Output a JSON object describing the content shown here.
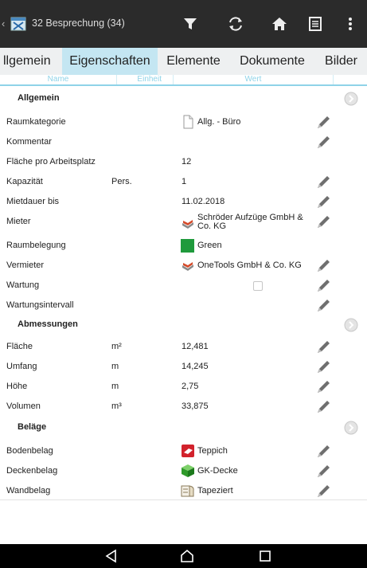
{
  "header": {
    "back_glyph": "‹",
    "title": "32 Besprechung (34)",
    "actions": [
      "filter-icon",
      "sync-icon",
      "home-icon",
      "list-icon",
      "more-vert-icon"
    ]
  },
  "tabs": [
    {
      "label": "llgemein",
      "active": false
    },
    {
      "label": "Eigenschaften",
      "active": true
    },
    {
      "label": "Elemente",
      "active": false
    },
    {
      "label": "Dokumente",
      "active": false
    },
    {
      "label": "Bilder",
      "active": false
    }
  ],
  "columns": {
    "name": "Name",
    "unit": "Einheit",
    "value": "Wert"
  },
  "groups": {
    "allgemein": "Allgemein",
    "abmessungen": "Abmessungen",
    "belaege": "Beläge"
  },
  "rows": {
    "raumkategorie": {
      "label": "Raumkategorie",
      "value": "Allg. - Büro",
      "icon": "document-icon"
    },
    "kommentar": {
      "label": "Kommentar",
      "value": ""
    },
    "flaeche_arbeitsplatz": {
      "label": "Fläche pro Arbeitsplatz",
      "value": "12"
    },
    "kapazitaet": {
      "label": "Kapazität",
      "unit": "Pers.",
      "value": "1"
    },
    "mietdauer": {
      "label": "Mietdauer bis",
      "value": "11.02.2018"
    },
    "mieter": {
      "label": "Mieter",
      "value": "Schröder Aufzüge GmbH & Co. KG",
      "icon": "bricks-icon"
    },
    "raumbelegung": {
      "label": "Raumbelegung",
      "value": "Green",
      "color": "#1f9a3c"
    },
    "vermieter": {
      "label": "Vermieter",
      "value": "OneTools GmbH & Co. KG",
      "icon": "bricks-icon"
    },
    "wartung": {
      "label": "Wartung",
      "checked": false
    },
    "wartungsintervall": {
      "label": "Wartungsintervall",
      "value": ""
    },
    "flaeche": {
      "label": "Fläche",
      "unit": "m²",
      "value": "12,481"
    },
    "umfang": {
      "label": "Umfang",
      "unit": "m",
      "value": "14,245"
    },
    "hoehe": {
      "label": "Höhe",
      "unit": "m",
      "value": "2,75"
    },
    "volumen": {
      "label": "Volumen",
      "unit": "m³",
      "value": "33,875"
    },
    "bodenbelag": {
      "label": "Bodenbelag",
      "value": "Teppich",
      "icon": "carpet-icon"
    },
    "deckenbelag": {
      "label": "Deckenbelag",
      "value": "GK-Decke",
      "icon": "ceiling-cube-icon"
    },
    "wandbelag": {
      "label": "Wandbelag",
      "value": "Tapeziert",
      "icon": "wallpaper-icon"
    }
  },
  "colors": {
    "topbar": "#2b2b2b",
    "tab_active": "#c4e6f2",
    "accent": "#8fd3e8",
    "pencil": "#6f6f6f"
  },
  "navbar": [
    "back-icon",
    "home-icon",
    "recents-icon"
  ]
}
